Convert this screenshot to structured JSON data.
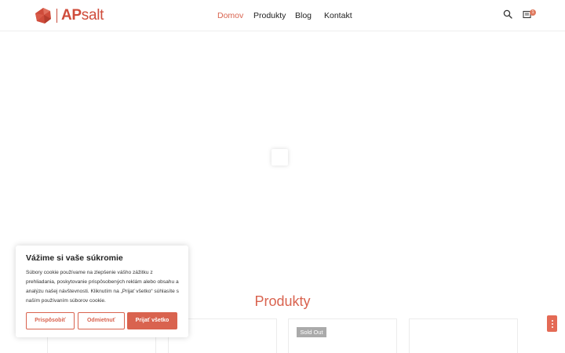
{
  "header": {
    "logo_ap": "AP",
    "logo_salt": "salt",
    "nav": [
      {
        "label": "Domov",
        "active": true
      },
      {
        "label": "Produkty",
        "active": false
      },
      {
        "label": "Blog",
        "active": false
      },
      {
        "label": "Kontakt",
        "active": false
      }
    ],
    "cart_count": "1",
    "icons": {
      "search": "search-icon",
      "cart": "cart-icon"
    }
  },
  "main": {
    "section_title": "Produkty",
    "cards": [
      {
        "badge": ""
      },
      {
        "badge": ""
      },
      {
        "badge": "Sold Out"
      },
      {
        "badge": ""
      }
    ]
  },
  "cookie": {
    "title": "Vážime si vaše súkromie",
    "text": "Súbory cookie používame na zlepšenie vášho zážitku z prehliadania, poskytovanie prispôsobených reklám alebo obsahu a analýzu našej návštevnosti. Kliknutím na „Prijať všetko“ súhlasíte s naším používaním súborov cookie.",
    "customize_label": "Prispôsobiť",
    "reject_label": "Odmietnuť",
    "accept_label": "Prijať všetko"
  },
  "colors": {
    "accent": "#d9634f",
    "brand": "#cf4c3b",
    "badge_gray": "#aaaaaa"
  }
}
